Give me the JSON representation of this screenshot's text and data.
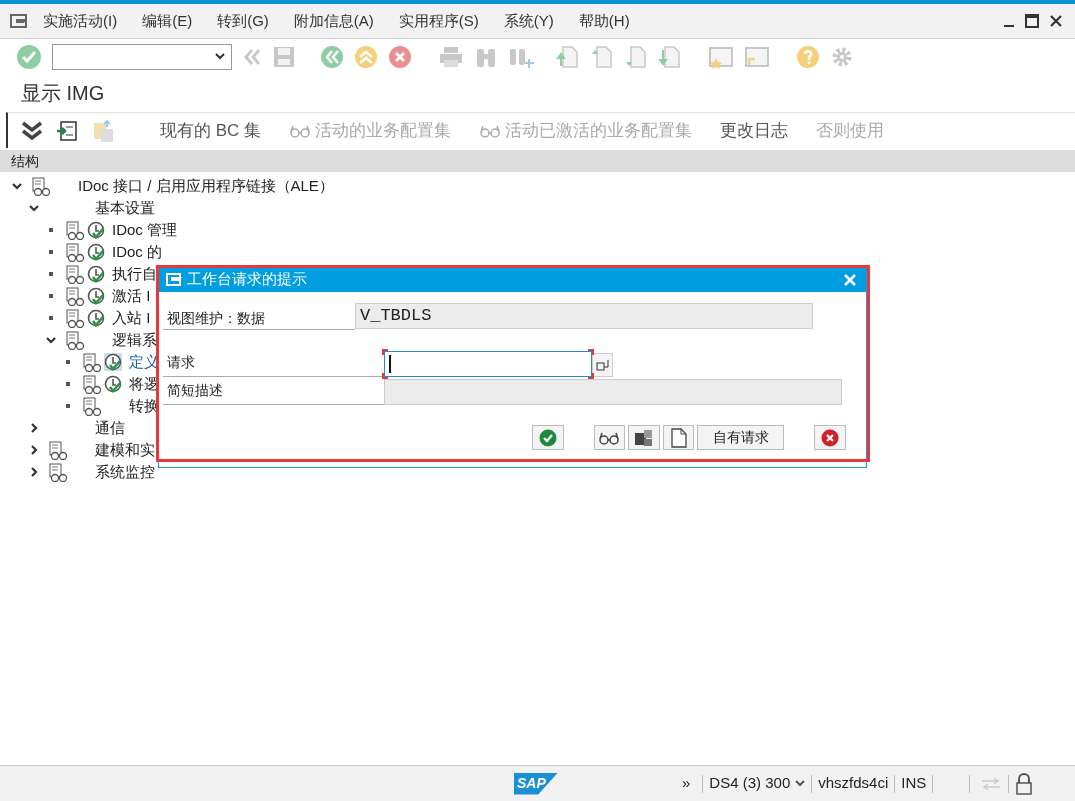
{
  "menu": [
    {
      "label": "实施活动(I)"
    },
    {
      "label": "编辑(E)"
    },
    {
      "label": "转到(G)"
    },
    {
      "label": "附加信息(A)"
    },
    {
      "label": "实用程序(S)"
    },
    {
      "label": "系统(Y)"
    },
    {
      "label": "帮助(H)"
    }
  ],
  "screen_title": "显示 IMG",
  "app_toolbar": [
    {
      "label": "现有的 BC 集",
      "disabled": false,
      "glasses": false
    },
    {
      "label": "活动的业务配置集",
      "disabled": true,
      "glasses": true
    },
    {
      "label": "活动已激活的业务配置集",
      "disabled": true,
      "glasses": true
    },
    {
      "label": "更改日志",
      "disabled": false,
      "glasses": false
    },
    {
      "label": "否则使用",
      "disabled": true,
      "glasses": false
    }
  ],
  "structure_header": "结构",
  "tree": [
    {
      "label": "IDoc 接口 / 启用应用程序链接（ALE）",
      "kind": "folder",
      "expanded": true,
      "doc": true,
      "exec": false,
      "selected": false,
      "children": [
        {
          "label": "基本设置",
          "kind": "folder",
          "expanded": true,
          "doc": false,
          "exec": false,
          "selected": false,
          "children": [
            {
              "label": "IDoc 管理",
              "kind": "leaf",
              "doc": true,
              "exec": true,
              "selected": false
            },
            {
              "label": "IDoc 的",
              "kind": "leaf",
              "doc": true,
              "exec": true,
              "selected": false
            },
            {
              "label": "执行自",
              "kind": "leaf",
              "doc": true,
              "exec": true,
              "selected": false
            },
            {
              "label": "激活 I",
              "kind": "leaf",
              "doc": true,
              "exec": true,
              "selected": false
            },
            {
              "label": "入站 I",
              "kind": "leaf",
              "doc": true,
              "exec": true,
              "selected": false
            },
            {
              "label": "逻辑系",
              "kind": "folder",
              "expanded": true,
              "doc": true,
              "exec": false,
              "selected": false,
              "children": [
                {
                  "label": "定义",
                  "kind": "leaf",
                  "doc": true,
                  "exec": true,
                  "selected": true
                },
                {
                  "label": "将逻",
                  "kind": "leaf",
                  "doc": true,
                  "exec": true,
                  "selected": false
                },
                {
                  "label": "转换",
                  "kind": "leaf",
                  "doc": true,
                  "exec": false,
                  "selected": false
                }
              ]
            }
          ]
        },
        {
          "label": "通信",
          "kind": "folder",
          "expanded": false,
          "doc": false,
          "exec": false,
          "selected": false
        },
        {
          "label": "建模和实",
          "kind": "folder",
          "expanded": false,
          "doc": true,
          "exec": false,
          "selected": false
        },
        {
          "label": "系统监控",
          "kind": "folder",
          "expanded": false,
          "doc": true,
          "exec": false,
          "selected": false
        }
      ]
    }
  ],
  "dialog": {
    "title": "工作台请求的提示",
    "view_label": "视图维护：数据",
    "view_value": "V_TBDLS",
    "request_label": "请求",
    "short_text_label": "简短描述",
    "own_requests_button": "自有请求"
  },
  "status_bar": {
    "logo": "SAP",
    "expand": "»",
    "system": "DS4 (3) 300",
    "server": "vhszfds4ci",
    "mode": "INS"
  }
}
